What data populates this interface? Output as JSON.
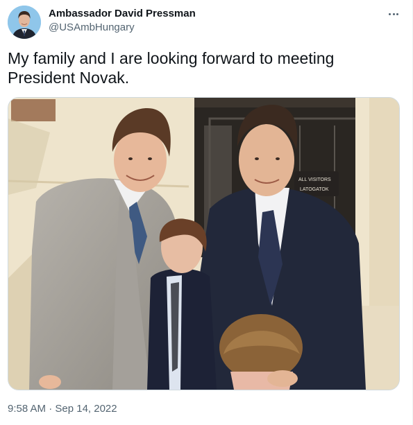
{
  "author": {
    "display_name": "Ambassador David Pressman",
    "handle": "@USAmbHungary",
    "avatar_icon": "profile-avatar"
  },
  "menu_icon": "more-options-icon",
  "tweet": {
    "text": "My family and I are looking forward to meeting President Novak.",
    "timestamp": "9:58 AM · Sep 14, 2022"
  },
  "photo": {
    "sign_line1": "ALL VISITORS",
    "sign_line2": "LATOGATOK"
  },
  "colors": {
    "text_primary": "#0f1419",
    "text_secondary": "#536471",
    "border": "#cfd9de"
  }
}
